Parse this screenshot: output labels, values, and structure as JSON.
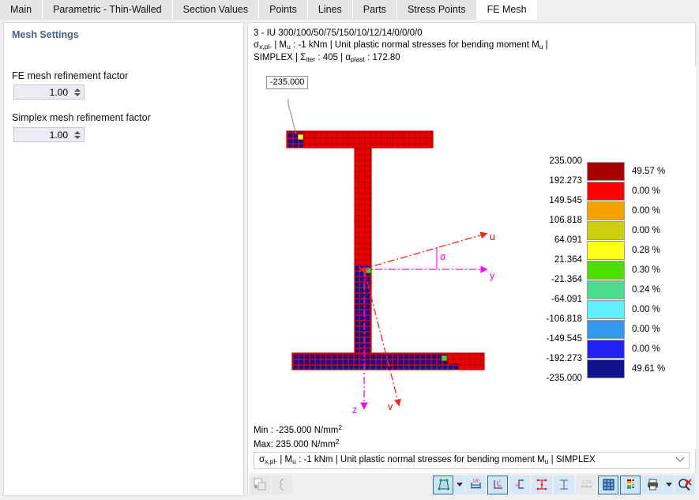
{
  "tabs": [
    {
      "label": "Main",
      "active": false
    },
    {
      "label": "Parametric - Thin-Walled",
      "active": false
    },
    {
      "label": "Section Values",
      "active": false
    },
    {
      "label": "Points",
      "active": false
    },
    {
      "label": "Lines",
      "active": false
    },
    {
      "label": "Parts",
      "active": false
    },
    {
      "label": "Stress Points",
      "active": false
    },
    {
      "label": "FE Mesh",
      "active": true
    }
  ],
  "left_panel": {
    "title": "Mesh Settings",
    "fields": [
      {
        "label": "FE mesh refinement factor",
        "value": "1.00"
      },
      {
        "label": "Simplex mesh refinement factor",
        "value": "1.00"
      }
    ]
  },
  "viewport": {
    "header_line1": "3 - IU 300/100/50/75/150/10/12/14/0/0/0/0",
    "header_line2_parts": {
      "sigma": "σ",
      "sigma_sub": "x,pl-",
      "sep1": " | M",
      "m_sub": "u",
      "mid": " : -1 kNm | Unit plastic normal stresses for bending moment M",
      "m_sub2": "u",
      "tail": " | SIMPLEX | ",
      "sigma_iter": "Σ",
      "iter_sub": "iter",
      "iter_val": " : 405 | ",
      "alpha": "α",
      "alpha_sub": "plast",
      "alpha_val": " : 172.80"
    },
    "callout_value": "-235.000",
    "axis_labels": {
      "u": "u",
      "y": "y",
      "z": "z",
      "v": "v",
      "alpha": "α"
    },
    "min_label": "Min :",
    "min_value": "-235.000 N/mm",
    "min_sup": "2",
    "max_label": "Max:",
    "max_value": "235.000 N/mm",
    "max_sup": "2",
    "combo": {
      "sigma": "σ",
      "sigma_sub": "x,pl-",
      "text_a": " | M",
      "m_sub": "u",
      "text_b": " : -1 kNm | Unit plastic normal stresses for bending moment M",
      "m_sub2": "u",
      "text_c": " | SIMPLEX"
    }
  },
  "chart_data": {
    "type": "heatmap",
    "title": "Unit plastic normal stresses for bending moment Mu (SIMPLEX)",
    "unit": "N/mm2",
    "min": -235.0,
    "max": 235.0,
    "legend_position": "right",
    "bands": [
      {
        "upper": "235.000",
        "lower": "192.273",
        "color": "#a80000",
        "percent": "49.57 %"
      },
      {
        "upper": "192.273",
        "lower": "149.545",
        "color": "#ff0000",
        "percent": "0.00 %"
      },
      {
        "upper": "149.545",
        "lower": "106.818",
        "color": "#f5a200",
        "percent": "0.00 %"
      },
      {
        "upper": "106.818",
        "lower": "64.091",
        "color": "#cfcf10",
        "percent": "0.00 %"
      },
      {
        "upper": "64.091",
        "lower": "21.364",
        "color": "#ffff1a",
        "percent": "0.28 %"
      },
      {
        "upper": "21.364",
        "lower": "-21.364",
        "color": "#4ddd00",
        "percent": "0.30 %"
      },
      {
        "upper": "-21.364",
        "lower": "-64.091",
        "color": "#4ddd8e",
        "percent": "0.24 %"
      },
      {
        "upper": "-64.091",
        "lower": "-106.818",
        "color": "#5ff0ff",
        "percent": "0.00 %"
      },
      {
        "upper": "-106.818",
        "lower": "-149.545",
        "color": "#3399ee",
        "percent": "0.00 %"
      },
      {
        "upper": "-149.545",
        "lower": "-192.273",
        "color": "#2222f5",
        "percent": "0.00 %"
      },
      {
        "upper": "-192.273",
        "lower": "-235.000",
        "color": "#12128c",
        "percent": "49.61 %"
      }
    ],
    "tick_labels": [
      "235.000",
      "192.273",
      "149.545",
      "106.818",
      "64.091",
      "21.364",
      "-21.364",
      "-64.091",
      "-106.818",
      "-149.545",
      "-192.273",
      "-235.000"
    ]
  },
  "toolbar": {
    "buttons": [
      {
        "name": "export-icon",
        "state": "disabled"
      },
      {
        "name": "section-outline-icon",
        "state": "disabled"
      },
      {
        "name": "render-solid-icon",
        "state": "selected"
      },
      {
        "name": "render-dropdown-arrow",
        "state": "dropdown"
      },
      {
        "name": "dimensions-icon",
        "state": "enabled"
      },
      {
        "name": "coordinate-system-icon",
        "state": "selected"
      },
      {
        "name": "shear-center-icon",
        "state": "enabled"
      },
      {
        "name": "stress-points-icon",
        "state": "enabled"
      },
      {
        "name": "parts-icon",
        "state": "enabled"
      },
      {
        "name": "numbering-icon",
        "state": "disabled"
      },
      {
        "name": "fe-mesh-grid-icon",
        "state": "selected"
      },
      {
        "name": "color-legend-icon",
        "state": "selected"
      },
      {
        "name": "print-icon",
        "state": "enabled"
      },
      {
        "name": "print-dropdown-arrow",
        "state": "dropdown"
      },
      {
        "name": "zoom-reset-icon",
        "state": "enabled"
      }
    ]
  }
}
